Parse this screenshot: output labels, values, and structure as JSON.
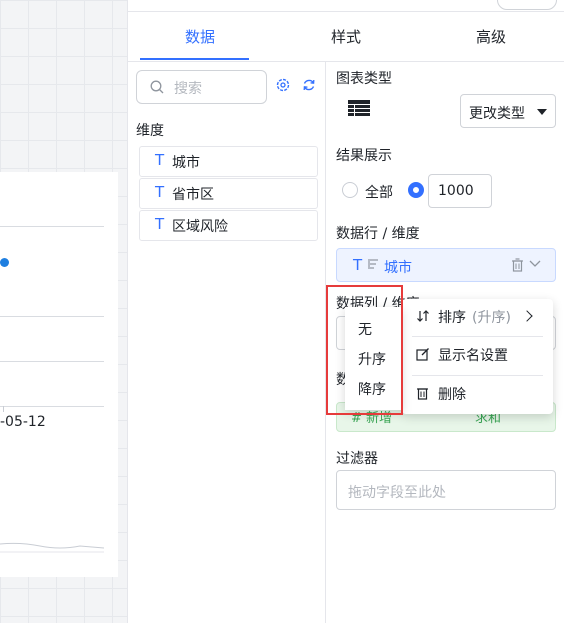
{
  "chart": {
    "x_tick": "-05-12"
  },
  "tabs": [
    "数据",
    "样式",
    "高级"
  ],
  "fields": {
    "search_placeholder": "搜索",
    "dimension_section": "维度",
    "type_glyph": "T",
    "items": [
      "城市",
      "省市区",
      "区域风险"
    ]
  },
  "config": {
    "chart_type_label": "图表类型",
    "change_type_button": "更改类型",
    "result_label": "结果展示",
    "radio_all": "全部",
    "limit_value": "1000",
    "rows_label": "数据行 / 维度",
    "row_pill": "城市",
    "cols_label": "数据列 / 维度",
    "values_label": "数",
    "green_pill_left": "# 新增",
    "green_pill_right": "求和",
    "filter_label": "过滤器",
    "filter_placeholder": "拖动字段至此处"
  },
  "context_menu": {
    "sort_label": "排序",
    "sort_state": "(升序)",
    "display_name": "显示名设置",
    "delete": "删除"
  },
  "sort_submenu": [
    "无",
    "升序",
    "降序"
  ],
  "colors": {
    "accent": "#3370ff",
    "highlight": "#e63b3b",
    "green": "#3aa655"
  }
}
